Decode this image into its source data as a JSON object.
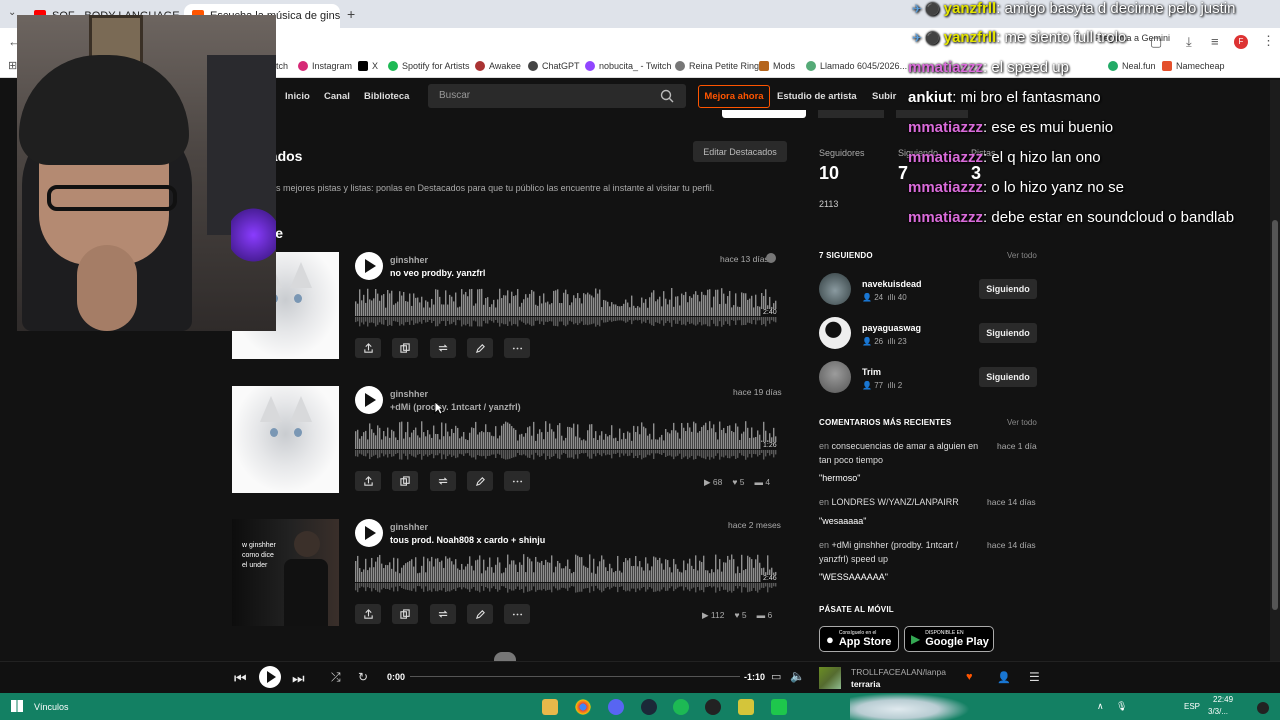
{
  "browser": {
    "tabs": [
      {
        "label": "SOF - BODY LANGUAGE (Offic",
        "fav": "#ff0000",
        "active": false
      },
      {
        "label": "Escucha la música de ginshher",
        "fav": "#ff5500",
        "active": true
      }
    ],
    "bookmarks": [
      "tch",
      "Instagram",
      "X",
      "Spotify for Artists",
      "Awakee",
      "ChatGPT",
      "nobucita_ - Twitch",
      "Reina Petite Ring",
      "Mods",
      "Llamado 6045/2026...",
      "Neal.fun",
      "Namecheap"
    ],
    "top_overlay": "Pregunta a Gemini"
  },
  "nav": {
    "links": [
      "Inicio",
      "Canal",
      "Biblioteca"
    ],
    "search_placeholder": "Buscar",
    "upgrade": "Mejora ahora",
    "artist_studio": "Estudio de artista",
    "upload": "Subir"
  },
  "spotlight": {
    "heading": "cados",
    "edit": "Editar Destacados",
    "hint": "s mejores pistas y listas: ponlas en Destacados para que tu público las encuentre al instante al visitar tu perfil."
  },
  "recent": {
    "heading": "nte"
  },
  "tracks": [
    {
      "artist": "ginshher",
      "title": "no veo prodby. yanzfrl",
      "ago": "hace 13 días",
      "duration": "2:40",
      "plays": "",
      "likes": "",
      "comments": ""
    },
    {
      "artist": "ginshher",
      "title": "+dMi (prodby. 1ntcart / yanzfrl)",
      "ago": "hace 19 días",
      "duration": "1:26",
      "plays": "68",
      "likes": "5",
      "comments": "4"
    },
    {
      "artist": "ginshher",
      "title": "tous prod. Noah808 x cardo + shinju",
      "ago": "hace 2 meses",
      "duration": "2:46",
      "plays": "112",
      "likes": "5",
      "comments": "6"
    }
  ],
  "cover3_text": "w ginshher\ncomo dice\nel under",
  "stats": {
    "followers_label": "Seguidores",
    "followers": "10",
    "following_label": "Siguiendo",
    "following": "7",
    "tracks_label": "Pistas",
    "tracks": "3",
    "extra": "2113"
  },
  "following_section": {
    "heading": "7 SIGUIENDO",
    "see_all": "Ver todo",
    "users": [
      {
        "name": "navekuisdead",
        "followers": "24",
        "tracks": "40",
        "button": "Siguiendo"
      },
      {
        "name": "payaguaswag",
        "followers": "26",
        "tracks": "23",
        "button": "Siguiendo"
      },
      {
        "name": "Trim",
        "followers": "77",
        "tracks": "2",
        "button": "Siguiendo"
      }
    ]
  },
  "comments_section": {
    "heading": "COMENTARIOS MÁS RECIENTES",
    "see_all": "Ver todo",
    "items": [
      {
        "prefix": "en",
        "track": "consecuencias de amar a alguien en tan poco tiempo",
        "ago": "hace 1 día",
        "text": "\"hermoso\""
      },
      {
        "prefix": "en",
        "track": "LONDRES W/YANZ/LANPAIRR",
        "ago": "hace 14 días",
        "text": "\"wesaaaaa\""
      },
      {
        "prefix": "en",
        "track": "+dMi ginshher (prodby. 1ntcart / yanzfrl) speed up",
        "ago": "hace 14 días",
        "text": "\"WESSAAAAAA\""
      }
    ]
  },
  "mobile": {
    "heading": "PÁSATE AL MÓVIL",
    "appstore_small": "Consíguelo en el",
    "appstore": "App Store",
    "googleplay_small": "DISPONIBLE EN",
    "googleplay": "Google Play"
  },
  "chat": [
    {
      "user": "yanzfrll",
      "msg": "amigo basyta d decirme pelo justin",
      "color": "#e6e600"
    },
    {
      "user": "yanzfrll",
      "msg": "me siento full trolo",
      "color": "#e6e600"
    },
    {
      "user": "mmatiazzz",
      "msg": "el speed up",
      "color": "#d96bd9"
    },
    {
      "user": "ankiut",
      "msg": "mi bro el fantasmano",
      "color": "#ffffff"
    },
    {
      "user": "mmatiazzz",
      "msg": "ese es mui buenio",
      "color": "#d96bd9"
    },
    {
      "user": "mmatiazzz",
      "msg": "el q hizo lan ono",
      "color": "#d96bd9"
    },
    {
      "user": "mmatiazzz",
      "msg": "o lo hizo yanz no se",
      "color": "#d96bd9"
    },
    {
      "user": "mmatiazzz",
      "msg": "debe estar en soundcloud o bandlab",
      "color": "#d96bd9"
    }
  ],
  "player": {
    "elapsed": "0:00",
    "remaining": "-1:10",
    "now_artist": "TROLLFACEALAN/lanpai",
    "now_title": "terraria",
    "progress": 0
  },
  "taskbar": {
    "label": "Vínculos",
    "lang": "ESP",
    "time": "22:49",
    "date": "3/3/..."
  }
}
